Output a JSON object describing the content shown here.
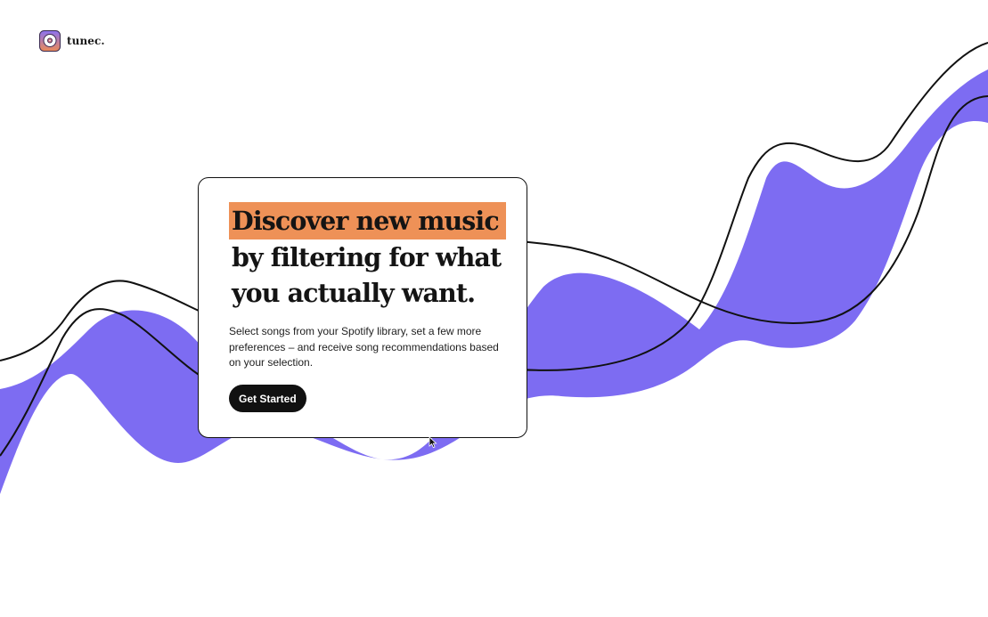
{
  "brand": {
    "name": "tunec.",
    "logo_icon": "record-icon",
    "logo_colors": {
      "top": "#8b72f0",
      "bottom": "#ec8a56"
    }
  },
  "hero": {
    "headline_highlight": "Discover new music",
    "headline_line2": "by filtering for what",
    "headline_line3": "you actually want.",
    "description": "Select songs from your Spotify library, set a few more preferences – and receive song recommendations based on your selection.",
    "cta_label": "Get Started"
  },
  "colors": {
    "wave_fill": "#7d6cf2",
    "wave_line": "#111111",
    "highlight": "#ee9157",
    "button_bg": "#111111",
    "button_text": "#ffffff"
  },
  "icons": [
    "record-icon",
    "cursor-icon"
  ]
}
